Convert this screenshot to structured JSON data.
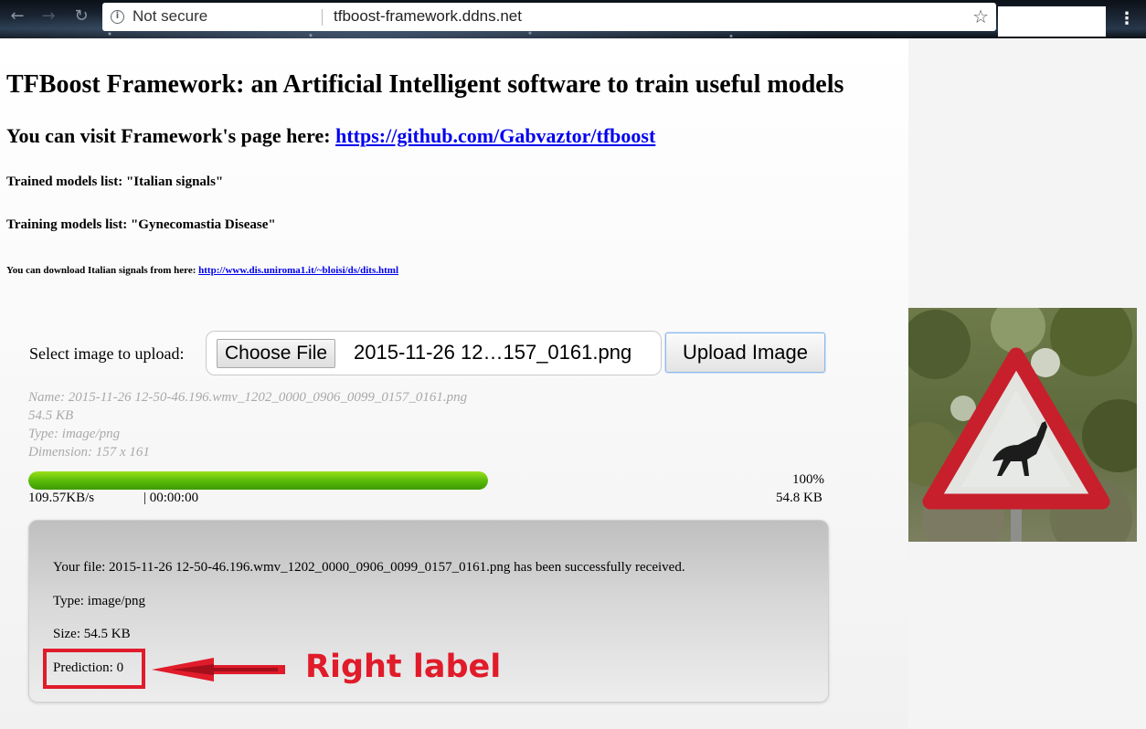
{
  "browser": {
    "security_label": "Not secure",
    "url": "tfboost-framework.ddns.net",
    "back_glyph": "←",
    "forward_glyph": "→",
    "reload_glyph": "↻",
    "star_glyph": "☆",
    "menu_glyph": "⋮",
    "info_glyph": "i"
  },
  "page": {
    "title": "TFBoost Framework: an Artificial Intelligent software to train useful models",
    "visit_prefix": "You can visit Framework's page here: ",
    "visit_link": "https://github.com/Gabvaztor/tfboost",
    "trained_models": "Trained models list: \"Italian signals\"",
    "training_models": "Training models list: \"Gynecomastia Disease\"",
    "download_prefix": "You can download Italian signals from here: ",
    "download_link": "http://www.dis.uniroma1.it/~bloisi/ds/dits.html"
  },
  "upload": {
    "label": "Select image to upload:",
    "choose_button": "Choose File",
    "selected_file": "2015-11-26 12…157_0161.png",
    "upload_button": "Upload Image",
    "meta": {
      "name": "Name: 2015-11-26 12-50-46.196.wmv_1202_0000_0906_0099_0157_0161.png",
      "size": "54.5 KB",
      "type": "Type: image/png",
      "dimension": "Dimension: 157 x 161"
    }
  },
  "progress": {
    "value": 1.0,
    "percent_text": "100%",
    "speed": "109.57KB/s",
    "time": "| 00:00:00",
    "size": "54.8 KB"
  },
  "result": {
    "file_line": "Your file: 2015-11-26 12-50-46.196.wmv_1202_0000_0906_0099_0157_0161.png has been successfully received.",
    "type_line": "Type: image/png",
    "size_line": "Size: 54.5 KB",
    "prediction_line": "Prediction: 0"
  },
  "annotation": {
    "text": "Right label",
    "color": "#e01b2a"
  },
  "preview_image": {
    "icon": "deer-crossing-warning-sign"
  }
}
